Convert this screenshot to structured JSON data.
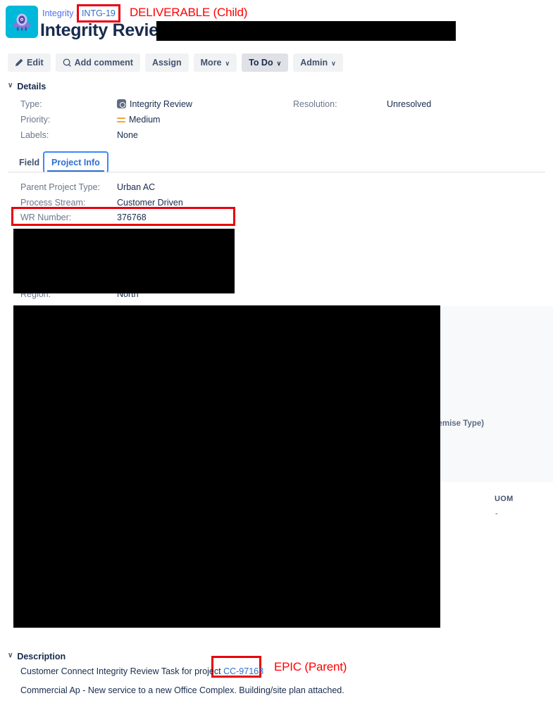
{
  "header": {
    "logo_icon": "ufo-telescope-logo",
    "breadcrumb": {
      "project": "Integrity",
      "separator": "/",
      "issue_key": "INTG-19"
    },
    "title_prefix": "Integrity Review:",
    "title_redacted": true
  },
  "annotations": {
    "child": "DELIVERABLE (Child)",
    "parent": "EPIC (Parent)",
    "color": "#ff0000",
    "box_color": "#e8000d"
  },
  "toolbar": {
    "edit_label": "Edit",
    "edit_icon": "pencil-icon",
    "add_comment_label": "Add comment",
    "add_comment_icon": "comment-icon",
    "assign_label": "Assign",
    "more_label": "More",
    "more_caret": "∨",
    "status_label": "To Do",
    "status_caret": "∨",
    "admin_label": "Admin",
    "admin_caret": "∨"
  },
  "details": {
    "section_title": "Details",
    "chevron": "∨",
    "fields": [
      {
        "label": "Type:",
        "value": "Integrity Review",
        "icon": "issue-type-icon"
      },
      {
        "label": "Priority:",
        "value": "Medium",
        "icon": "priority-medium-icon"
      },
      {
        "label": "Labels:",
        "value": "None",
        "icon": ""
      },
      {
        "label": "Resolution:",
        "value": "Unresolved",
        "icon": ""
      }
    ]
  },
  "tabs": {
    "items": [
      {
        "label": "Field",
        "active": false
      },
      {
        "label": "Project Info",
        "active": true
      }
    ]
  },
  "project_info": {
    "fields": [
      {
        "label": "Parent Project Type:",
        "value": "Urban AC"
      },
      {
        "label": "Process Stream:",
        "value": "Customer Driven"
      },
      {
        "label": "WR Number:",
        "value": "376768",
        "highlighted": true
      },
      {
        "label": "Region:",
        "value": "North"
      }
    ]
  },
  "side_panel": {
    "premise_type_label": "remise Type)",
    "uom_label": "UOM",
    "uom_value": "-"
  },
  "description": {
    "section_title": "Description",
    "chevron": "∨",
    "line1_prefix": "Customer Connect Integrity Review Task for project ",
    "line1_link": "CC-97168",
    "line2": "Commercial Ap - New service to a new Office Complex. Building/site plan attached."
  }
}
